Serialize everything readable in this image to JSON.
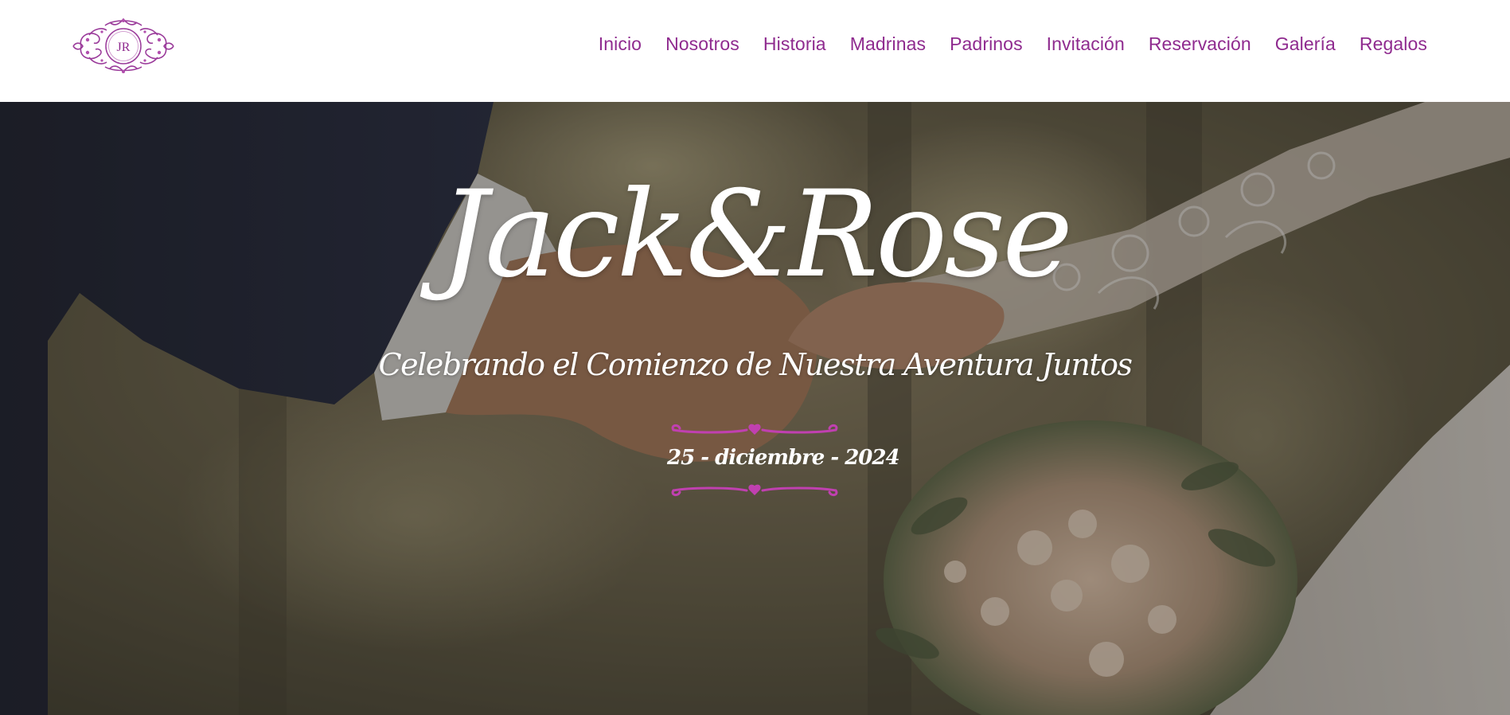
{
  "brand": {
    "monogram": "JR",
    "accent_color": "#8f2b8f",
    "ornament_color": "#c040b0"
  },
  "nav": {
    "items": [
      {
        "label": "Inicio",
        "id": "inicio"
      },
      {
        "label": "Nosotros",
        "id": "nosotros"
      },
      {
        "label": "Historia",
        "id": "historia"
      },
      {
        "label": "Madrinas",
        "id": "madrinas"
      },
      {
        "label": "Padrinos",
        "id": "padrinos"
      },
      {
        "label": "Invitación",
        "id": "invitacion"
      },
      {
        "label": "Reservación",
        "id": "reservacion"
      },
      {
        "label": "Galería",
        "id": "galeria"
      },
      {
        "label": "Regalos",
        "id": "regalos"
      }
    ]
  },
  "hero": {
    "title": "Jack&Rose",
    "subtitle": "Celebrando el Comienzo de Nuestra Aventura Juntos",
    "date": "25 - diciembre - 2024",
    "background_description_icon": "couple-holding-hands-photo"
  }
}
